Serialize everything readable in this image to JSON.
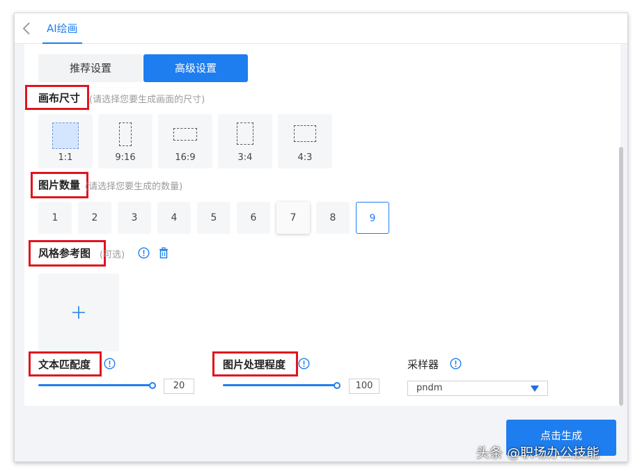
{
  "header": {
    "tab_label": "AI绘画"
  },
  "tabs": {
    "recommend": "推荐设置",
    "advanced": "高级设置"
  },
  "canvas_size": {
    "title": "画布尺寸",
    "hint": "(请选择您要生成画面的尺寸)",
    "options": [
      {
        "label": "1:1",
        "selected": true
      },
      {
        "label": "9:16",
        "selected": false
      },
      {
        "label": "16:9",
        "selected": false
      },
      {
        "label": "3:4",
        "selected": false
      },
      {
        "label": "4:3",
        "selected": false
      }
    ]
  },
  "image_count": {
    "title": "图片数量",
    "hint": "(请选择您要生成的数量)",
    "options": [
      "1",
      "2",
      "3",
      "4",
      "5",
      "6",
      "7",
      "8",
      "9"
    ],
    "selected": "9",
    "hovered": "7"
  },
  "style_reference": {
    "title": "风格参考图",
    "hint": "(可选)",
    "icons": [
      "info-icon",
      "trash-icon"
    ],
    "upload_icon": "plus-icon"
  },
  "text_match": {
    "title": "文本匹配度",
    "value": "20",
    "level": 1.0
  },
  "image_processing": {
    "title": "图片处理程度",
    "value": "100",
    "level": 1.0
  },
  "sampler": {
    "title": "采样器",
    "selected": "pndm"
  },
  "actions": {
    "generate": "点击生成"
  },
  "watermark": "头条 @职场办公技能",
  "colors": {
    "accent": "#1e7ef0",
    "highlight_box": "#e0141e"
  }
}
